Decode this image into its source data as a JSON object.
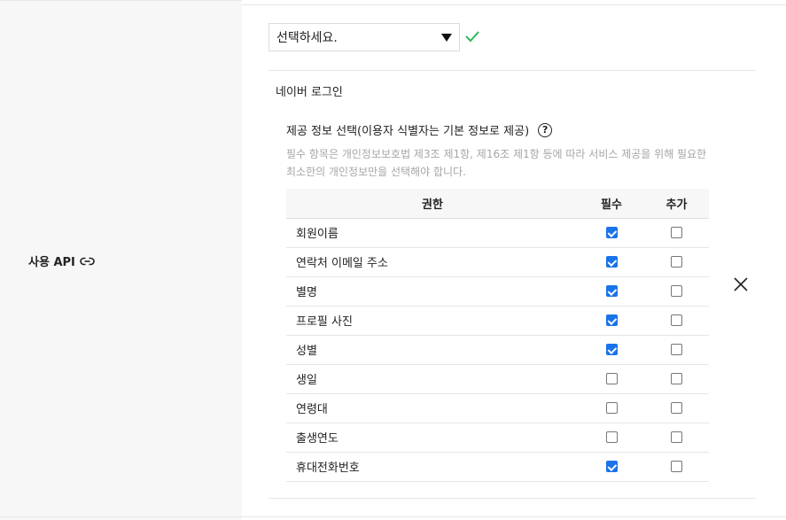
{
  "api_label": "사용 API",
  "select": {
    "value": "선택하세요."
  },
  "provider": {
    "title": "네이버 로그인"
  },
  "info": {
    "title": "제공 정보 선택(이용자 식별자는 기본 정보로 제공)",
    "help": "?",
    "description": "필수 항목은 개인정보보호법 제3조 제1항, 제16조 제1항 등에 따라 서비스 제공을 위해 필요한 최소한의 개인정보만을 선택해야 합니다."
  },
  "table": {
    "headers": {
      "permission": "권한",
      "required": "필수",
      "additional": "추가"
    },
    "rows": [
      {
        "name": "회원이름",
        "required": true,
        "additional": false
      },
      {
        "name": "연락처 이메일 주소",
        "required": true,
        "additional": false
      },
      {
        "name": "별명",
        "required": true,
        "additional": false
      },
      {
        "name": "프로필 사진",
        "required": true,
        "additional": false
      },
      {
        "name": "성별",
        "required": true,
        "additional": false
      },
      {
        "name": "생일",
        "required": false,
        "additional": false
      },
      {
        "name": "연령대",
        "required": false,
        "additional": false
      },
      {
        "name": "출생연도",
        "required": false,
        "additional": false
      },
      {
        "name": "휴대전화번호",
        "required": true,
        "additional": false
      }
    ]
  },
  "colors": {
    "check_green": "#2fb65a",
    "checkbox_blue": "#1a73e8",
    "panel_bg": "#f7f7f7"
  },
  "icons": {
    "link": "link-icon",
    "arrow": "dropdown-arrow-icon",
    "valid": "checkmark-icon",
    "close": "close-icon"
  }
}
